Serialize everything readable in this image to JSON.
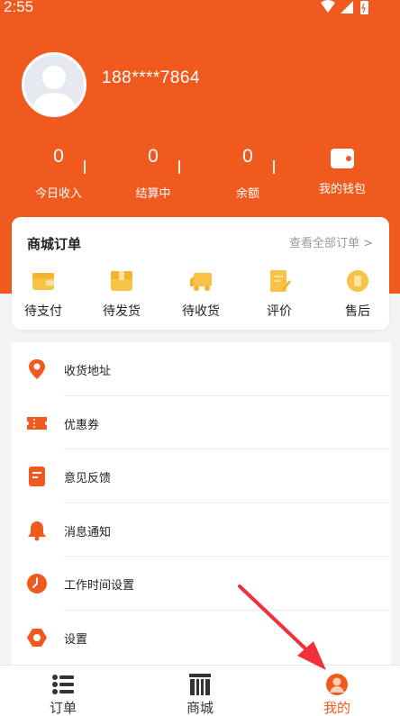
{
  "status_bar": {
    "time": "2:55"
  },
  "profile": {
    "phone": "188****7864"
  },
  "stats": [
    {
      "value": "0",
      "label": "今日收入"
    },
    {
      "value": "0",
      "label": "结算中"
    },
    {
      "value": "0",
      "label": "余额"
    }
  ],
  "wallet": {
    "label": "我的钱包",
    "icon": "wallet-icon"
  },
  "orders": {
    "title": "商城订单",
    "view_all": "查看全部订单 >",
    "items": [
      {
        "label": "待支付",
        "icon": "wallet-icon"
      },
      {
        "label": "待发货",
        "icon": "box-icon"
      },
      {
        "label": "待收货",
        "icon": "truck-icon"
      },
      {
        "label": "评价",
        "icon": "review-icon"
      },
      {
        "label": "售后",
        "icon": "coin-icon"
      }
    ]
  },
  "menu": [
    {
      "label": "收货地址",
      "icon": "location-icon"
    },
    {
      "label": "优惠券",
      "icon": "coupon-icon"
    },
    {
      "label": "意见反馈",
      "icon": "feedback-icon"
    },
    {
      "label": "消息通知",
      "icon": "bell-icon"
    },
    {
      "label": "工作时间设置",
      "icon": "clock-icon"
    },
    {
      "label": "设置",
      "icon": "settings-icon"
    }
  ],
  "tabs": [
    {
      "label": "订单",
      "icon": "list-icon",
      "active": false
    },
    {
      "label": "商城",
      "icon": "store-icon",
      "active": false
    },
    {
      "label": "我的",
      "icon": "profile-icon",
      "active": true
    }
  ],
  "colors": {
    "brand": "#f05a1e",
    "order_icon": "#f7c346",
    "background": "#f4f4f4"
  }
}
